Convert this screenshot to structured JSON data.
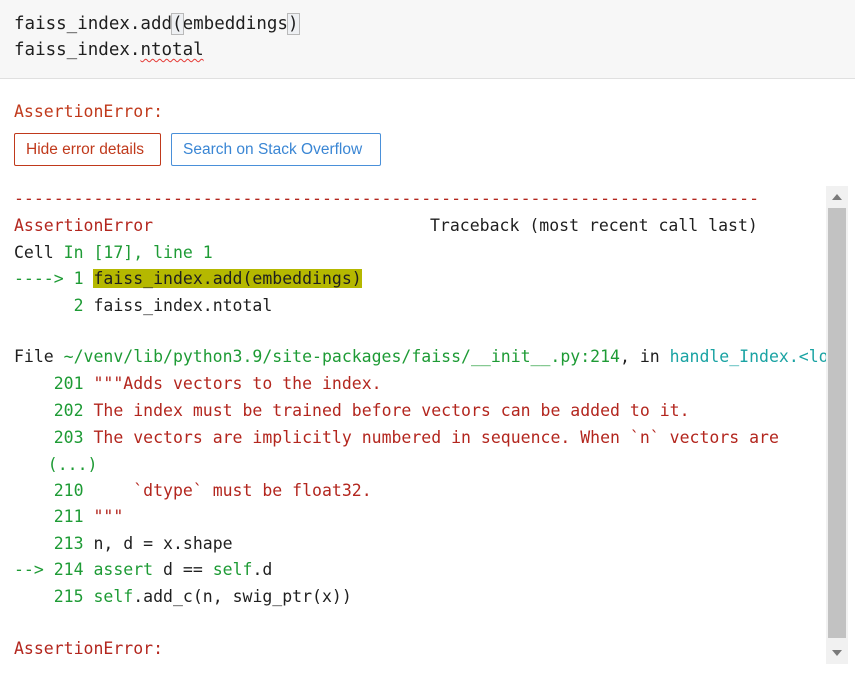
{
  "input": {
    "line1_prefix": "faiss_index.add",
    "line1_open": "(",
    "line1_arg": "embeddings",
    "line1_close": ")",
    "line2_prefix": "faiss_index.",
    "line2_attr": "ntotal"
  },
  "error": {
    "title": "AssertionError:",
    "hide_button": "Hide error details",
    "so_button": "Search on Stack Overflow"
  },
  "traceback": {
    "rule": "---------------------------------------------------------------------------",
    "err_name": "AssertionError",
    "header_right": "Traceback (most recent call last)",
    "cell_word": "Cell ",
    "cell_ref": "In [17], line 1",
    "arrow1": "----> 1 ",
    "arrow1_code": "faiss_index.add(embeddings)",
    "line2_num": "      2 ",
    "line2_code": "faiss_index.ntotal",
    "file_word": "File ",
    "file_path": "~/venv/lib/python3.9/site-packages/faiss/__init__.py:214",
    "file_in": ", in ",
    "file_func": "handle_Index.<lo",
    "l201_num": "    201 ",
    "l201_code": "\"\"\"Adds vectors to the index.",
    "l202_num": "    202 ",
    "l202_code": "The index must be trained before vectors can be added to it.",
    "l203_num": "    203 ",
    "l203_code": "The vectors are implicitly numbered in sequence. When `n` vectors are",
    "ellipsis": "   (...)",
    "l210_num": "    210 ",
    "l210_code": "    `dtype` must be float32.",
    "l211_num": "    211 ",
    "l211_code": "\"\"\"",
    "l213_num": "    213 ",
    "l213_code": "n, d = x.shape",
    "l214_arrow": "--> 214 ",
    "l214_assert": "assert",
    "l214_mid": " d == ",
    "l214_self": "self",
    "l214_end": ".d",
    "l215_num": "    215 ",
    "l215_self": "self",
    "l215_code": ".add_c(n, swig_ptr(x))",
    "final": "AssertionError:"
  }
}
